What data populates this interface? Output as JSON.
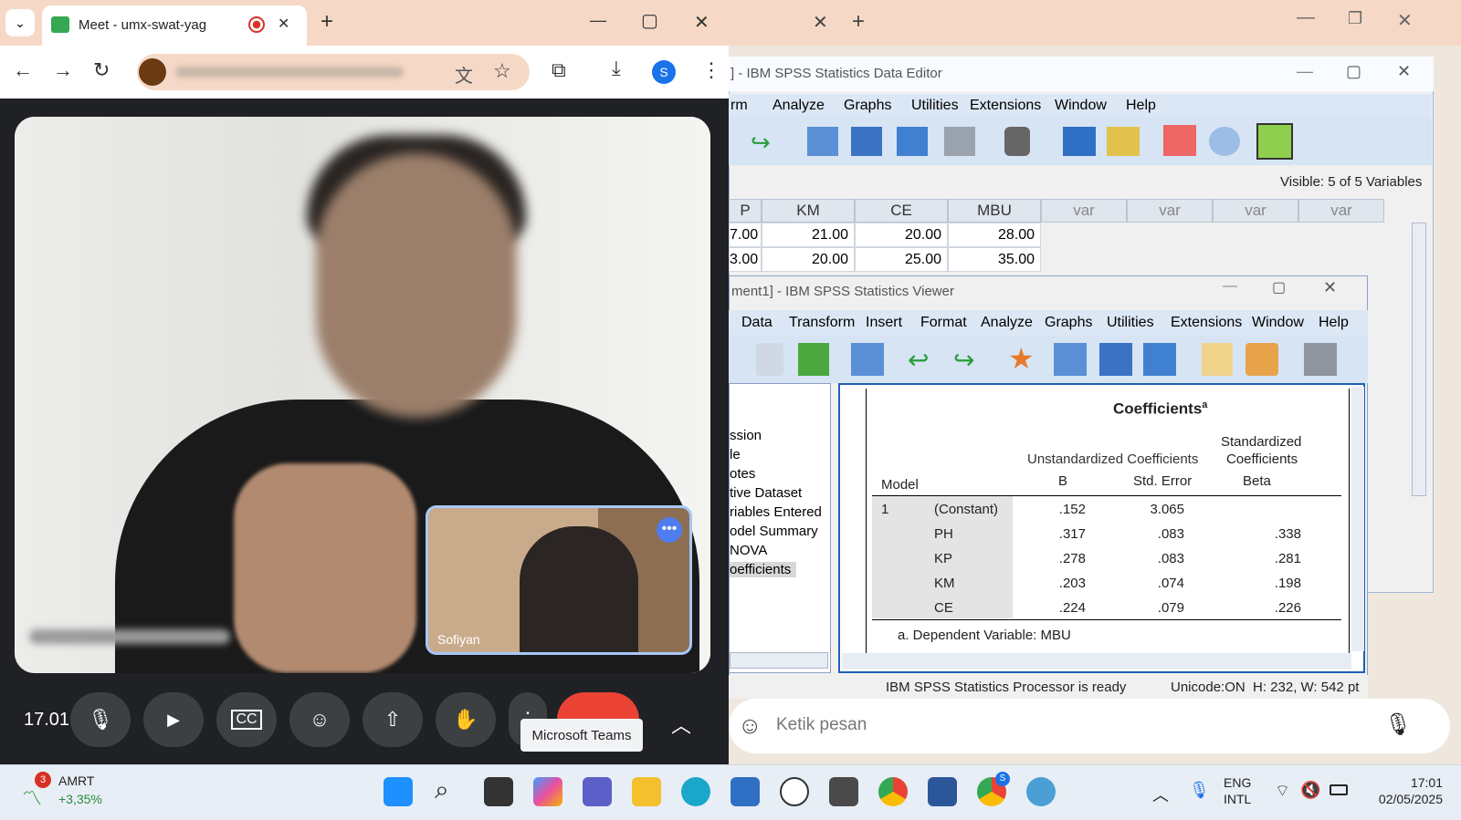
{
  "chrome": {
    "tab_title": "Meet - umx-swat-yag",
    "new_tab": "+",
    "minimize": "—",
    "maximize": "▢",
    "close": "✕",
    "profile_initial": "S"
  },
  "meet": {
    "time": "17.01",
    "pip_name": "Sofiyan",
    "pip_more": "•••",
    "tooltip": "Microsoft Teams"
  },
  "whatsapp": {
    "message_placeholder": "Ketik pesan"
  },
  "spss_editor": {
    "title": "] - IBM SPSS Statistics Data Editor",
    "menu": [
      "rm",
      "Analyze",
      "Graphs",
      "Utilities",
      "Extensions",
      "Window",
      "Help"
    ],
    "visible": "Visible: 5 of 5 Variables",
    "columns": [
      "P",
      "KM",
      "CE",
      "MBU",
      "var",
      "var",
      "var",
      "var"
    ],
    "rows": [
      [
        "7.00",
        "21.00",
        "20.00",
        "28.00"
      ],
      [
        "3.00",
        "20.00",
        "25.00",
        "35.00"
      ]
    ]
  },
  "spss_viewer": {
    "title": "ment1] - IBM SPSS Statistics Viewer",
    "menu": [
      "Data",
      "Transform",
      "Insert",
      "Format",
      "Analyze",
      "Graphs",
      "Utilities",
      "Extensions",
      "Window",
      "Help"
    ],
    "outline": [
      "ssion",
      "le",
      "otes",
      "tive Dataset",
      "riables Entered",
      "odel Summary",
      "NOVA",
      "oefficients"
    ],
    "table_title": "Coefficients",
    "table_title_sup": "a",
    "hdr_unstd": "Unstandardized Coefficients",
    "hdr_std_1": "Standardized",
    "hdr_std_2": "Coefficients",
    "hdr_model": "Model",
    "hdr_b": "B",
    "hdr_se": "Std. Error",
    "hdr_beta": "Beta",
    "model_num": "1",
    "rows": [
      {
        "name": "(Constant)",
        "b": ".152",
        "se": "3.065",
        "beta": ""
      },
      {
        "name": "PH",
        "b": ".317",
        "se": ".083",
        "beta": ".338"
      },
      {
        "name": "KP",
        "b": ".278",
        "se": ".083",
        "beta": ".281"
      },
      {
        "name": "KM",
        "b": ".203",
        "se": ".074",
        "beta": ".198"
      },
      {
        "name": "CE",
        "b": ".224",
        "se": ".079",
        "beta": ".226"
      }
    ],
    "footnote": "a. Dependent Variable: MBU",
    "status_ready": "IBM SPSS Statistics Processor is ready",
    "status_unicode": "Unicode:ON",
    "status_dims": "H: 232, W: 542 pt"
  },
  "taskbar": {
    "stock_badge": "3",
    "stock_name": "AMRT",
    "stock_change": "+3,35%",
    "lang_1": "ENG",
    "lang_2": "INTL",
    "time": "17:01",
    "date": "02/05/2025",
    "chrome_badge": "S"
  }
}
